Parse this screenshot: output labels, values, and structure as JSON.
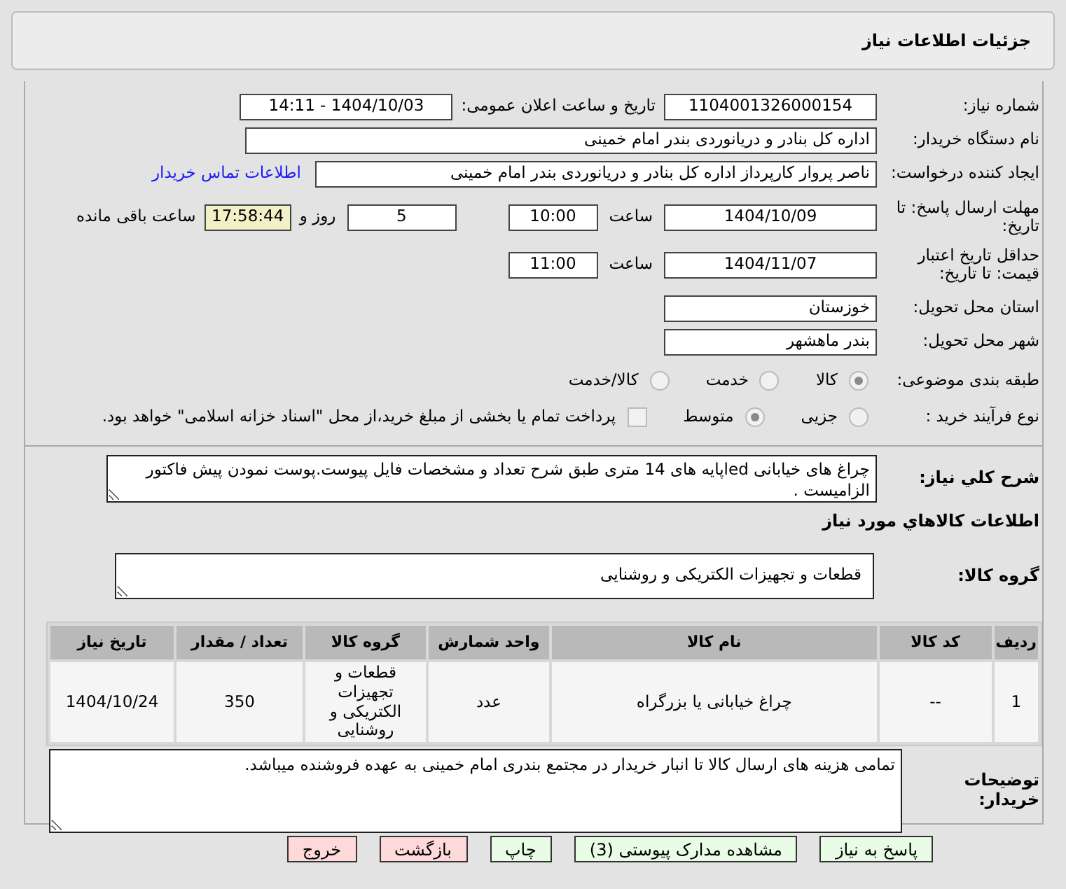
{
  "header": {
    "title": "جزئیات اطلاعات نیاز"
  },
  "need_number": {
    "label": "شماره نیاز:",
    "value": "1104001326000154"
  },
  "announce": {
    "label": "تاریخ و ساعت اعلان عمومی:",
    "value": "1404/10/03 - 14:11"
  },
  "buyer": {
    "label": "نام دستگاه خریدار:",
    "value": "اداره کل بنادر و دریانوردی بندر امام خمینی"
  },
  "requester": {
    "label": "ایجاد کننده درخواست:",
    "value": "ناصر پروار کارپرداز اداره کل بنادر و دریانوردی بندر امام خمینی",
    "link": "اطلاعات تماس خریدار"
  },
  "deadline": {
    "label": "مهلت ارسال پاسخ: تا تاریخ:",
    "date": "1404/10/09",
    "time_label": "ساعت",
    "time": "10:00",
    "days": "5",
    "days_label": "روز و",
    "remaining": "17:58:44",
    "remaining_label": "ساعت باقی مانده"
  },
  "validity": {
    "label": "حداقل تاریخ اعتبار قیمت: تا تاریخ:",
    "date": "1404/11/07",
    "time_label": "ساعت",
    "time": "11:00"
  },
  "province": {
    "label": "استان محل تحویل:",
    "value": "خوزستان"
  },
  "city": {
    "label": "شهر محل تحویل:",
    "value": "بندر ماهشهر"
  },
  "category": {
    "label": "طبقه بندی موضوعی:",
    "options": [
      {
        "label": "کالا",
        "selected": true
      },
      {
        "label": "خدمت",
        "selected": false
      },
      {
        "label": "کالا/خدمت",
        "selected": false
      }
    ]
  },
  "process": {
    "label": "نوع فرآیند خرید :",
    "options": [
      {
        "label": "جزیی",
        "selected": false
      },
      {
        "label": "متوسط",
        "selected": true
      }
    ],
    "payment": {
      "checked": false,
      "text": "پرداخت تمام یا بخشی از مبلغ خرید،از محل \"اسناد خزانه اسلامی\" خواهد بود."
    }
  },
  "description": {
    "label": "شرح کلي نياز:",
    "value": "چراغ های خیابانی ledپایه های 14 متری طبق شرح تعداد و مشخصات فایل پیوست.پوست نمودن پیش فاکتور الزامیست ."
  },
  "goods_heading": "اطلاعات کالاهاي مورد نياز",
  "goods_group": {
    "label": "گروه کالا:",
    "value": "قطعات و تجهیزات الکتریکی و روشنایی"
  },
  "table": {
    "columns": [
      "ردیف",
      "کد کالا",
      "نام کالا",
      "واحد شمارش",
      "گروه کالا",
      "تعداد / مقدار",
      "تاریخ نیاز"
    ],
    "rows": [
      [
        "1",
        "--",
        "چراغ خیابانی یا بزرگراه",
        "عدد",
        "قطعات و تجهیزات الکتریکی و روشنایی",
        "350",
        "1404/10/24"
      ]
    ]
  },
  "buyer_notes": {
    "label": "توضیحات خریدار:",
    "value": "تمامی هزینه های ارسال کالا تا انبار خریدار در مجتمع بندری امام خمینی به عهده فروشنده میباشد."
  },
  "buttons": [
    {
      "label": "پاسخ به نیاز",
      "kind": "go"
    },
    {
      "label": "مشاهده مدارک پیوستی (3)",
      "kind": "go"
    },
    {
      "label": "چاپ",
      "kind": "go"
    },
    {
      "label": "بازگشت",
      "kind": "stop"
    },
    {
      "label": "خروج",
      "kind": "stop"
    }
  ]
}
